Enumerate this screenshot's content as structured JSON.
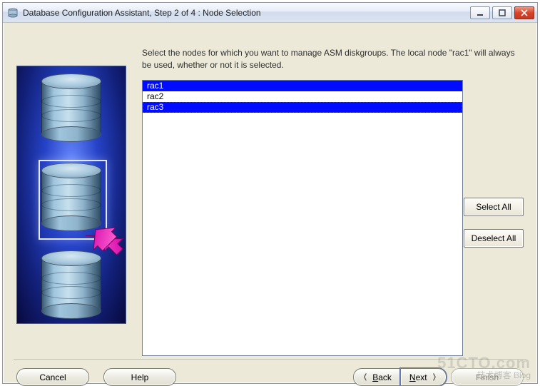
{
  "window": {
    "title": "Database Configuration Assistant, Step 2 of 4 : Node Selection"
  },
  "instruction": "Select the nodes for which you want to manage ASM diskgroups.  The local node \"rac1\" will always be used, whether or not it is selected.",
  "nodes": [
    {
      "label": "rac1",
      "selected": true,
      "focused": false
    },
    {
      "label": "rac2",
      "selected": false,
      "focused": false
    },
    {
      "label": "rac3",
      "selected": true,
      "focused": true
    }
  ],
  "side_buttons": {
    "select_all": "Select All",
    "deselect_all": "Deselect All"
  },
  "bottom": {
    "cancel": "Cancel",
    "help": "Help",
    "back_u": "B",
    "back_rest": "ack",
    "next_u": "N",
    "next_rest": "ext",
    "finish": "Finish"
  },
  "watermark": {
    "big": "51CTO.com",
    "small": "技术博客    Blog"
  }
}
